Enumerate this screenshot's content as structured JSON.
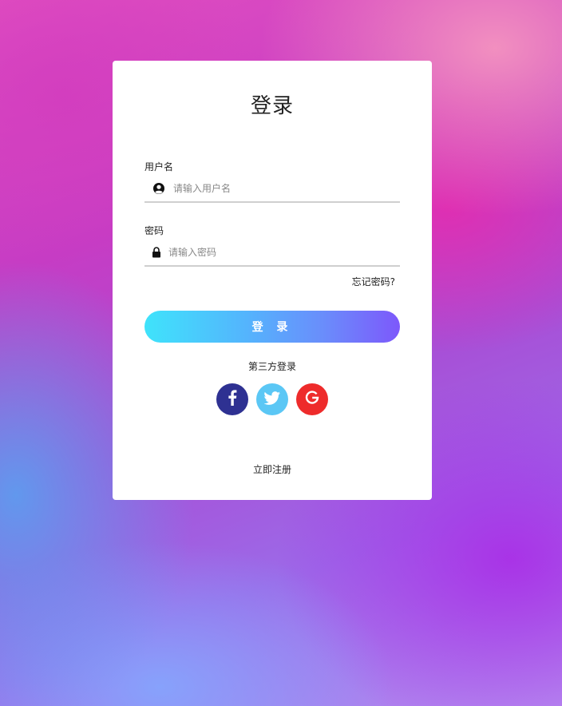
{
  "login_card": {
    "title": "登录",
    "username": {
      "label": "用户名",
      "placeholder": "请输入用户名",
      "value": "",
      "icon": "user-circle-icon"
    },
    "password": {
      "label": "密码",
      "placeholder": "请输入密码",
      "value": "",
      "icon": "lock-icon"
    },
    "forgot_password": "忘记密码?",
    "login_button": "登 录",
    "third_party_label": "第三方登录",
    "social_buttons": [
      {
        "name": "facebook",
        "icon": "facebook-icon",
        "color": "#2e3192"
      },
      {
        "name": "twitter",
        "icon": "twitter-icon",
        "color": "#5bc7f5"
      },
      {
        "name": "google",
        "icon": "google-icon",
        "color": "#ee2b2b"
      }
    ],
    "register_link": "立即注册"
  },
  "colors": {
    "button_gradient_start": "#3fe3fb",
    "button_gradient_end": "#7d58fb"
  }
}
